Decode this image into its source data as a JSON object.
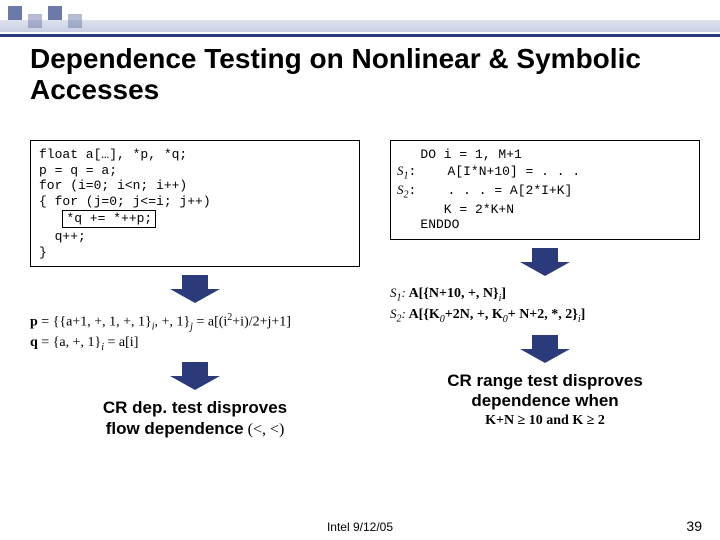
{
  "title": "Dependence Testing on Nonlinear & Symbolic Accesses",
  "left": {
    "code": {
      "l1": "float a[…], *p, *q;",
      "l2": "p = q = a;",
      "l3": "for (i=0; i<n; i++)",
      "l4": "{ for (j=0; j<=i; j++)",
      "l5": "*q += *++p;",
      "l6": "  q++;",
      "l7": "}"
    },
    "expr": {
      "p_lead": "p",
      "p_rest": " = {{a+1, +, 1, +, 1}",
      "p_sub1": "i",
      "p_mid": ", +, 1}",
      "p_sub2": "j",
      "p_eq": " = a[(i",
      "p_sup": "2",
      "p_tail": "+i)/2+j+1]",
      "q_lead": "q",
      "q_rest": " = {a, +, 1}",
      "q_sub": "i",
      "q_tail": " = a[i]"
    },
    "conc": {
      "l1": "CR dep. test disproves",
      "l2": "flow dependence",
      "suffix": " (<, <)"
    }
  },
  "right": {
    "code": {
      "l1a": "   DO i = 1, M+1",
      "s1": "S",
      "s1sub": "1",
      "s1colon": ":",
      "l2": "    A[I*N+10] = . . .",
      "s2": "S",
      "s2sub": "2",
      "s2colon": ":",
      "l3": "    . . . = A[2*I+K]",
      "l4": "      K = 2*K+N",
      "l5": "   ENDDO"
    },
    "expr": {
      "s1": "S",
      "s1sub": "1",
      "s1line": "  A[{N+10, +, N}",
      "s1sub2": "i",
      "s1tail": "]",
      "s2": "S",
      "s2sub": "2",
      "s2line": "  A[{K",
      "s2sub0": "0",
      "s2mid": "+2N, +, K",
      "s2sub0b": "0",
      "s2mid2": "+ N+2, *, 2}",
      "s2subi": "i",
      "s2tail": "]"
    },
    "conc": {
      "l1": "CR range test disproves",
      "l2": "dependence when",
      "sub_a": "K+N ",
      "sub_ge1": "≥",
      "sub_b": " 10 and K ",
      "sub_ge2": "≥",
      "sub_c": " 2"
    }
  },
  "footer": {
    "date": "Intel 9/12/05",
    "page": "39"
  }
}
